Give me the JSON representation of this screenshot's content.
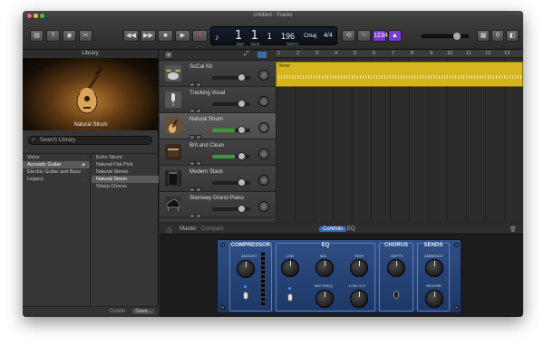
{
  "window": {
    "title": "Untitled - Tracks"
  },
  "lcd": {
    "bar": "1",
    "beat": "1",
    "div": "1",
    "tick": "1",
    "tempo": "96",
    "key": "Cmaj",
    "signature": "4/4"
  },
  "lcd_labels": {
    "bar_lbl": "BAR",
    "beat_lbl": "BEAT",
    "tempo_lbl": "TEMPO"
  },
  "library": {
    "title": "Library",
    "preview_caption": "Natural Strum",
    "search_placeholder": "Search Library",
    "categories": [
      {
        "label": "Voice",
        "selected": false
      },
      {
        "label": "Acoustic Guitar",
        "selected": true
      },
      {
        "label": "Electric Guitar and Bass",
        "selected": false
      },
      {
        "label": "Legacy",
        "selected": false
      }
    ],
    "patches": [
      {
        "label": "Echo Strum",
        "selected": false
      },
      {
        "label": "Natural Flat Pick",
        "selected": false
      },
      {
        "label": "Natural Stereo",
        "selected": false
      },
      {
        "label": "Natural Strum",
        "selected": true
      },
      {
        "label": "Sharp Chorus",
        "selected": false
      }
    ],
    "delete_label": "Delete",
    "save_label": "Save..."
  },
  "tracks": [
    {
      "name": "SoCal Kit",
      "icon": "drum-kit-icon",
      "selected": false
    },
    {
      "name": "Tracking Vocal",
      "icon": "microphone-icon",
      "selected": false
    },
    {
      "name": "Natural Strum",
      "icon": "acoustic-guitar-icon",
      "selected": true
    },
    {
      "name": "Brit and Clean",
      "icon": "amp-icon",
      "selected": false
    },
    {
      "name": "Modern Stack",
      "icon": "amp-stack-icon",
      "selected": false
    },
    {
      "name": "Steinway Grand Piano",
      "icon": "grand-piano-icon",
      "selected": false
    }
  ],
  "ruler": [
    "1",
    "2",
    "3",
    "4",
    "5",
    "6",
    "7",
    "8",
    "9",
    "10",
    "11",
    "12",
    "13"
  ],
  "region": {
    "label": "Verse"
  },
  "smart_controls": {
    "master": "Master",
    "compare": "Compare",
    "tab_controls": "Controls",
    "tab_eq": "EQ",
    "compressor": "COMPRESSOR",
    "amount": "AMOUNT",
    "eq": "EQ",
    "low": "LOW",
    "mid": "MID",
    "high": "HIGH",
    "mid_freq": "MID FREQ",
    "low_cut": "LOW CUT",
    "chorus": "CHORUS",
    "depth": "DEPTH",
    "sends": "SENDS",
    "ambience": "AMBIENCE",
    "reverb": "REVERB"
  },
  "colors": {
    "accent": "#3a6ea8",
    "region": "#d6b51f",
    "panel": "#2f4f86",
    "meter": "#2f9d39"
  }
}
